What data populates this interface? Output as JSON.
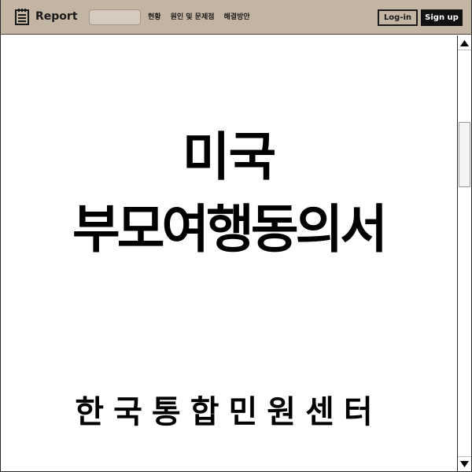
{
  "header": {
    "brand": "Report",
    "search": {
      "value": "",
      "placeholder": ""
    },
    "nav": [
      {
        "label": "현황"
      },
      {
        "label": "원인 및 문제점"
      },
      {
        "label": "해결방안"
      }
    ],
    "login_label": "Log-in",
    "signup_label": "Sign up"
  },
  "main": {
    "title_line1": "미국",
    "title_line2": "부모여행동의서",
    "subtitle": "한국통합민원센터"
  },
  "colors": {
    "header_bg": "#c3b5a4",
    "signup_bg": "#111111",
    "text": "#000000"
  },
  "icons": {
    "brand_icon": "document-list-icon",
    "scroll_up": "arrow-up-icon",
    "scroll_down": "arrow-down-icon"
  }
}
